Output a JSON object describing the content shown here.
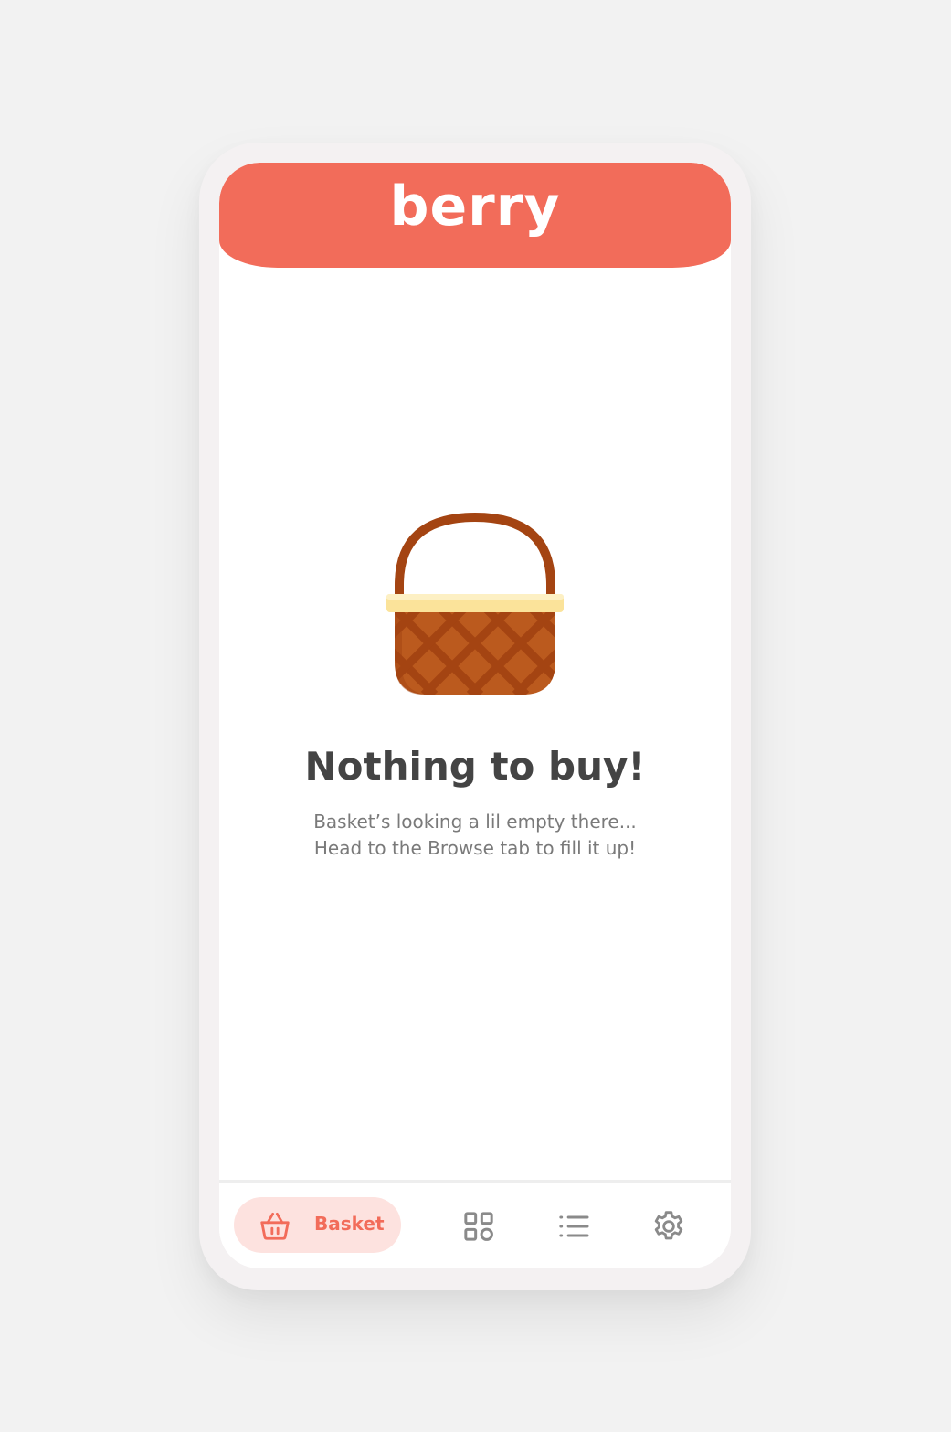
{
  "app": {
    "name": "berry"
  },
  "empty_state": {
    "illustration": "wicker-basket-illustration",
    "title": "Nothing to buy!",
    "line1": "Basket’s looking a lil empty there...",
    "line2": "Head to the Browse tab to fill it up!"
  },
  "bottom_nav": {
    "items": [
      {
        "label": "Basket",
        "icon": "basket-icon",
        "active": true
      },
      {
        "label": "",
        "icon": "grid-icon",
        "active": false
      },
      {
        "label": "",
        "icon": "list-icon",
        "active": false
      },
      {
        "label": "",
        "icon": "gear-icon",
        "active": false
      }
    ]
  },
  "colors": {
    "brand": "#f26c5a",
    "active_pill": "#fde2df",
    "text_dark": "#444444",
    "text_muted": "#7a7a7a",
    "icon_inactive": "#8a8a8a"
  }
}
